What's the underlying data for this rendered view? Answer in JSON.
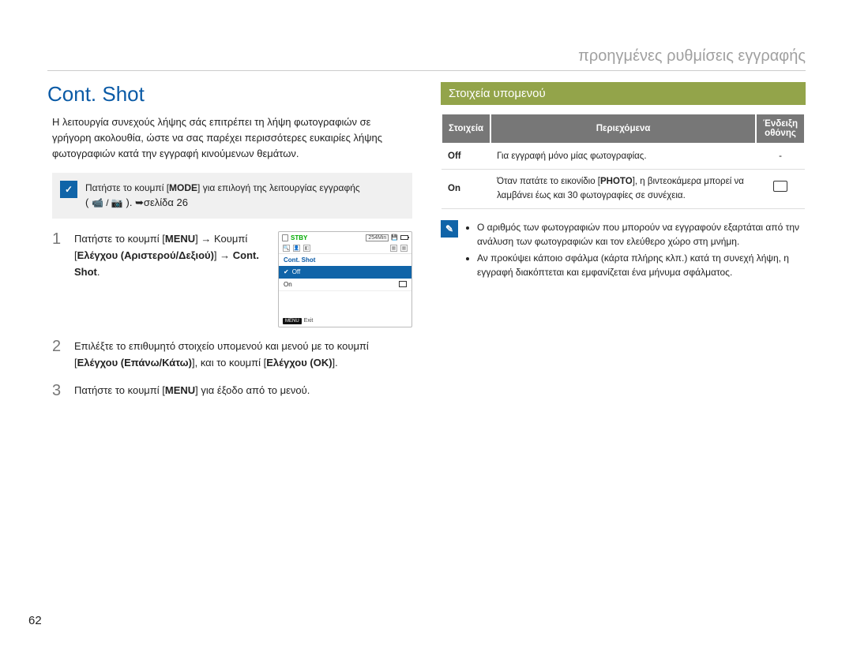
{
  "running_head": "προηγμένες ρυθμίσεις εγγραφής",
  "section_title": "Cont. Shot",
  "intro": "Η λειτουργία συνεχούς λήψης σάς επιτρέπει τη λήψη φωτογραφιών σε γρήγορη ακολουθία, ώστε να σας παρέχει περισσότερες ευκαιρίες λήψης φωτογραφιών κατά την εγγραφή κινούμενων θεμάτων.",
  "tip": {
    "pre": "Πατήστε το κουμπί [",
    "mode": "MODE",
    "post": "] για επιλογή της λειτουργίας εγγραφής",
    "line2_left": "( ",
    "line2_right": " ). ➥σελίδα 26"
  },
  "steps": {
    "s1_a": "Πατήστε το κουμπί [",
    "s1_menu": "MENU",
    "s1_b": "] → Κουμπί [",
    "s1_ctrl_lr": "Ελέγχου (Αριστερού/Δεξιού)",
    "s1_c": "] → ",
    "s1_cont": "Cont. Shot",
    "s1_d": ".",
    "s2_a": "Επιλέξτε το επιθυμητό στοιχείο υπομενού και μενού με το κουμπί [",
    "s2_ctrl_ud": "Ελέγχου (Επάνω/Κάτω)",
    "s2_b": "], και το κουμπί [",
    "s2_ctrl_ok": "Ελέγχου (ΟΚ)",
    "s2_c": "].",
    "s3_a": "Πατήστε το κουμπί [",
    "s3_menu": "MENU",
    "s3_b": "] για έξοδο από το μενού."
  },
  "lcd": {
    "stby": "STBY",
    "time": "254Min",
    "title": "Cont. Shot",
    "opt_off": "Off",
    "opt_on": "On",
    "exit_label": "Exit",
    "menu_badge": "MENU"
  },
  "submenu_heading": "Στοιχεία υπομενού",
  "table": {
    "h1": "Στοιχεία",
    "h2": "Περιεχόμενα",
    "h3": "Ένδειξη οθόνης",
    "row_off_item": "Off",
    "row_off_desc": "Για εγγραφή μόνο μίας φωτογραφίας.",
    "row_off_disp": "-",
    "row_on_item": "On",
    "row_on_a": "Όταν πατάτε το εικονίδιο [",
    "row_on_photo": "PHOTO",
    "row_on_b": "], η βιντεοκάμερα μπορεί να λαμβάνει έως και 30 φωτογραφίες σε συνέχεια."
  },
  "notes": {
    "n1": "Ο αριθμός των φωτογραφιών που μπορούν να εγγραφούν εξαρτάται από την ανάλυση των φωτογραφιών και τον ελεύθερο χώρο στη μνήμη.",
    "n2": "Αν προκύψει κάποιο σφάλμα (κάρτα πλήρης κλπ.) κατά τη συνεχή λήψη, η εγγραφή διακόπτεται και εμφανίζεται ένα μήνυμα σφάλματος."
  },
  "page_number": "62"
}
